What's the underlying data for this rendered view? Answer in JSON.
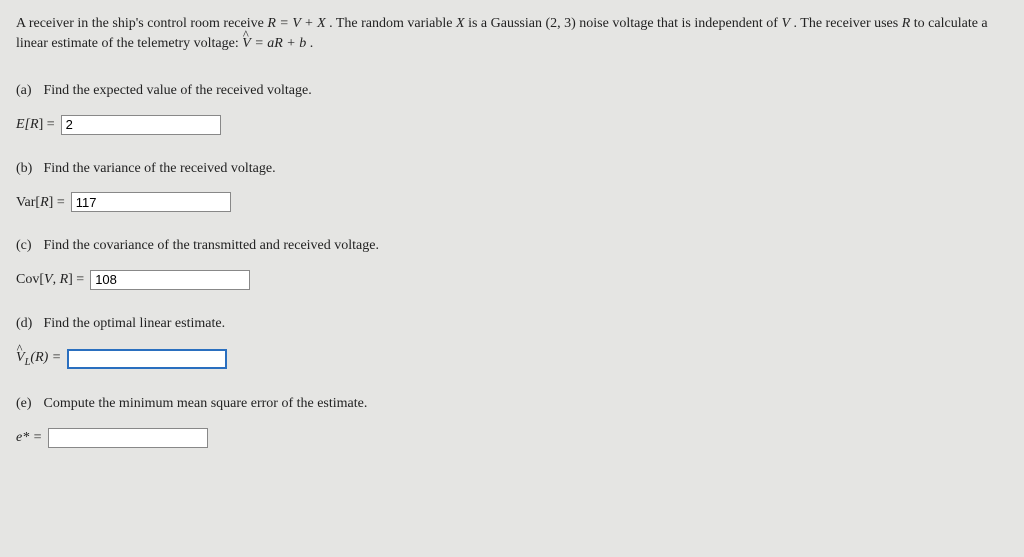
{
  "intro": {
    "line1_a": "A receiver in the ship's control room receive ",
    "eq1": "R = V + X",
    "line1_b": ". The random variable ",
    "X": "X",
    "line1_c": " is a Gaussian ",
    "gauss": "(2, 3)",
    "line1_d": " noise voltage that is independent of ",
    "V": "V",
    "line1_e": ". The receiver uses ",
    "R": "R",
    "line1_f": " to calculate a linear estimate of the telemetry voltage: ",
    "eq2_lhs": "V",
    "eq2_rhs": " = aR + b",
    "period": "."
  },
  "parts": {
    "a": {
      "label": "(a)",
      "prompt": "Find the expected value of the received voltage.",
      "lhs_pre": "E[",
      "lhs_var": "R",
      "lhs_post": "] = ",
      "value": "2"
    },
    "b": {
      "label": "(b)",
      "prompt": "Find the variance of the received voltage.",
      "lhs_pre": "Var[",
      "lhs_var": "R",
      "lhs_post": "] = ",
      "value": "117"
    },
    "c": {
      "label": "(c)",
      "prompt": "Find the covariance of the transmitted and received voltage.",
      "lhs_pre": "Cov[",
      "lhs_v1": "V",
      "lhs_comma": ", ",
      "lhs_v2": "R",
      "lhs_post": "] = ",
      "value": "108"
    },
    "d": {
      "label": "(d)",
      "prompt": "Find the optimal linear estimate.",
      "lhs_hat": "V",
      "lhs_sub": "L",
      "lhs_paren": "(R) = ",
      "value": ""
    },
    "e": {
      "label": "(e)",
      "prompt": "Compute the minimum mean square error of the estimate.",
      "lhs": "e* = ",
      "value": ""
    }
  }
}
